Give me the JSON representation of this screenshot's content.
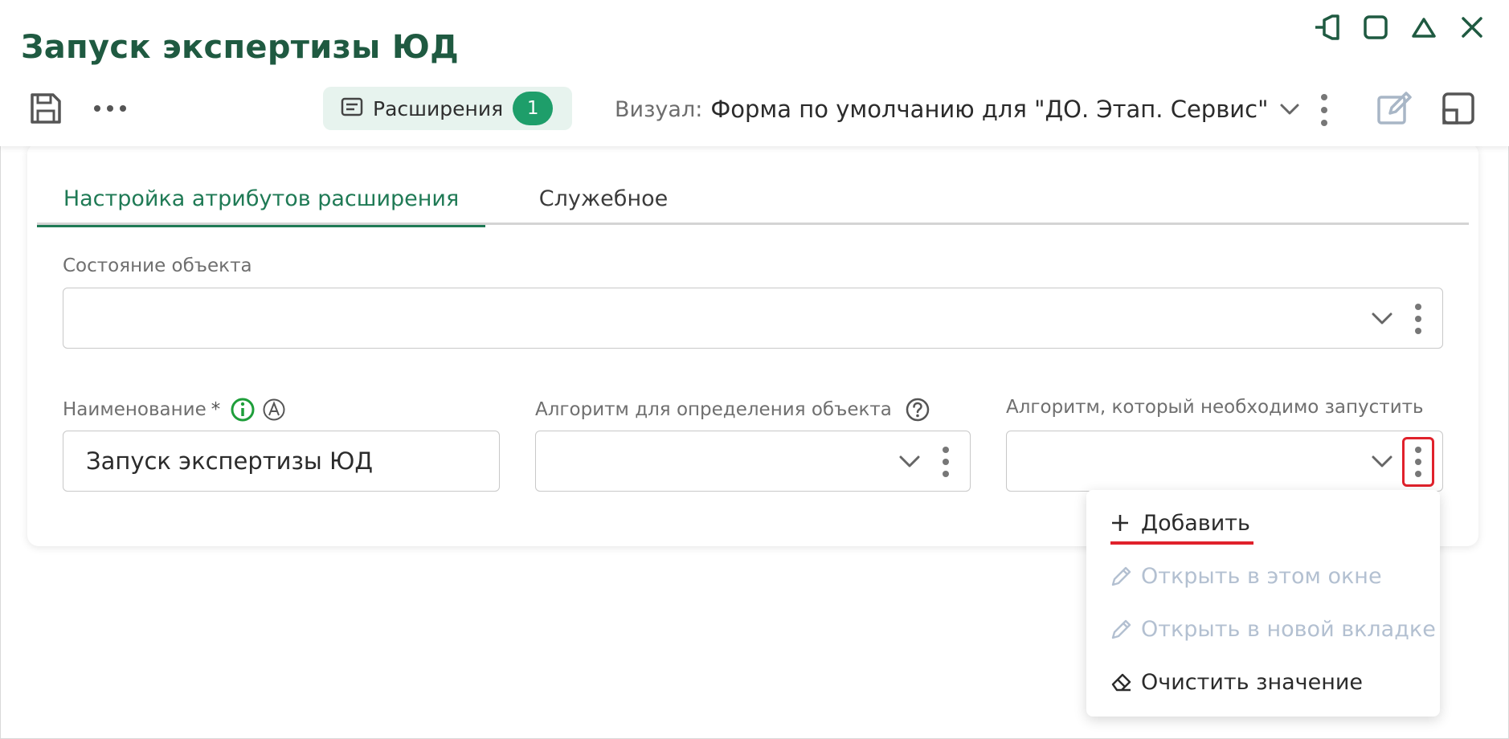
{
  "header": {
    "title": "Запуск экспертизы ЮД",
    "extensions_label": "Расширения",
    "extensions_count": "1",
    "visual_label": "Визуал:",
    "visual_value": "Форма по умолчанию для \"ДО. Этап. Сервис\""
  },
  "tabs": [
    {
      "label": "Настройка атрибутов расширения",
      "active": true
    },
    {
      "label": "Служебное",
      "active": false
    }
  ],
  "fields": {
    "object_state": {
      "label": "Состояние объекта",
      "value": ""
    },
    "name": {
      "label": "Наименование",
      "required_mark": "*",
      "value": "Запуск экспертизы ЮД"
    },
    "object_algorithm": {
      "label": "Алгоритм для определения объекта",
      "value": ""
    },
    "run_algorithm": {
      "label": "Алгоритм, который необходимо запустить",
      "value": ""
    }
  },
  "menu": {
    "items": [
      {
        "label": "Добавить",
        "icon": "plus-icon",
        "enabled": true
      },
      {
        "label": "Открыть в этом окне",
        "icon": "pencil-icon",
        "enabled": false
      },
      {
        "label": "Открыть в новой вкладке",
        "icon": "pencil-icon",
        "enabled": false
      },
      {
        "label": "Очистить значение",
        "icon": "eraser-icon",
        "enabled": true
      }
    ]
  },
  "colors": {
    "title": "#1f5a41",
    "accent": "#1f7a55",
    "badge": "#1e9e6a",
    "chip_bg": "#e7f3ee",
    "highlight": "#e0212b",
    "disabled_text": "#b3c0d1"
  }
}
